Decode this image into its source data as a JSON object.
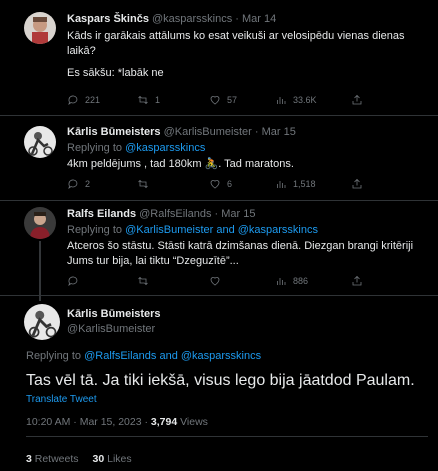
{
  "tweets": [
    {
      "name": "Kaspars Škinčs",
      "handle": "@kasparsskincs · Mar 14",
      "text1": "Kāds ir garākais attālums ko esat veikuši ar velosipēdu vienas dienas laikā?",
      "text2": "Es sākšu: *labāk ne",
      "replies": "221",
      "retweets": "1",
      "likes": "57",
      "views": "33.6K"
    },
    {
      "name": "Kārlis Būmeisters",
      "handle": "@KarlisBumeister · Mar 15",
      "replying_prefix": "Replying to ",
      "replying_to": "@kasparsskincs",
      "text": "4km peldējums , tad 180km 🚴‍. Tad maratons.",
      "replies": "2",
      "retweets": "",
      "likes": "6",
      "views": "1,518"
    },
    {
      "name": "Ralfs Eilands",
      "handle": "@RalfsEilands · Mar 15",
      "replying_prefix": "Replying to ",
      "replying_to": "@KarlisBumeister and @kasparsskincs",
      "text1": "Atceros šo stāstu. Stāsti katrā dzimšanas dienā. Diezgan brangi kritēriji",
      "text2": "Jums tur bija, lai tiktu “Dzeguzītē”...",
      "replies": "",
      "retweets": "",
      "likes": "",
      "views": "886"
    }
  ],
  "main": {
    "name": "Kārlis Būmeisters",
    "handle": "@KarlisBumeister",
    "replying_prefix": "Replying to ",
    "replying_to": "@RalfsEilands and @kasparsskincs",
    "text": "Tas vēl tā. Ja tiki iekšā, visus lego bija jāatdod Paulam.",
    "translate": "Translate Tweet",
    "timestamp": "10:20 AM · Mar 15, 2023 · ",
    "views_count": "3,794",
    "views_label": " Views",
    "retweets_count": "3",
    "retweets_label": " Retweets",
    "likes_count": "30",
    "likes_label": " Likes"
  }
}
